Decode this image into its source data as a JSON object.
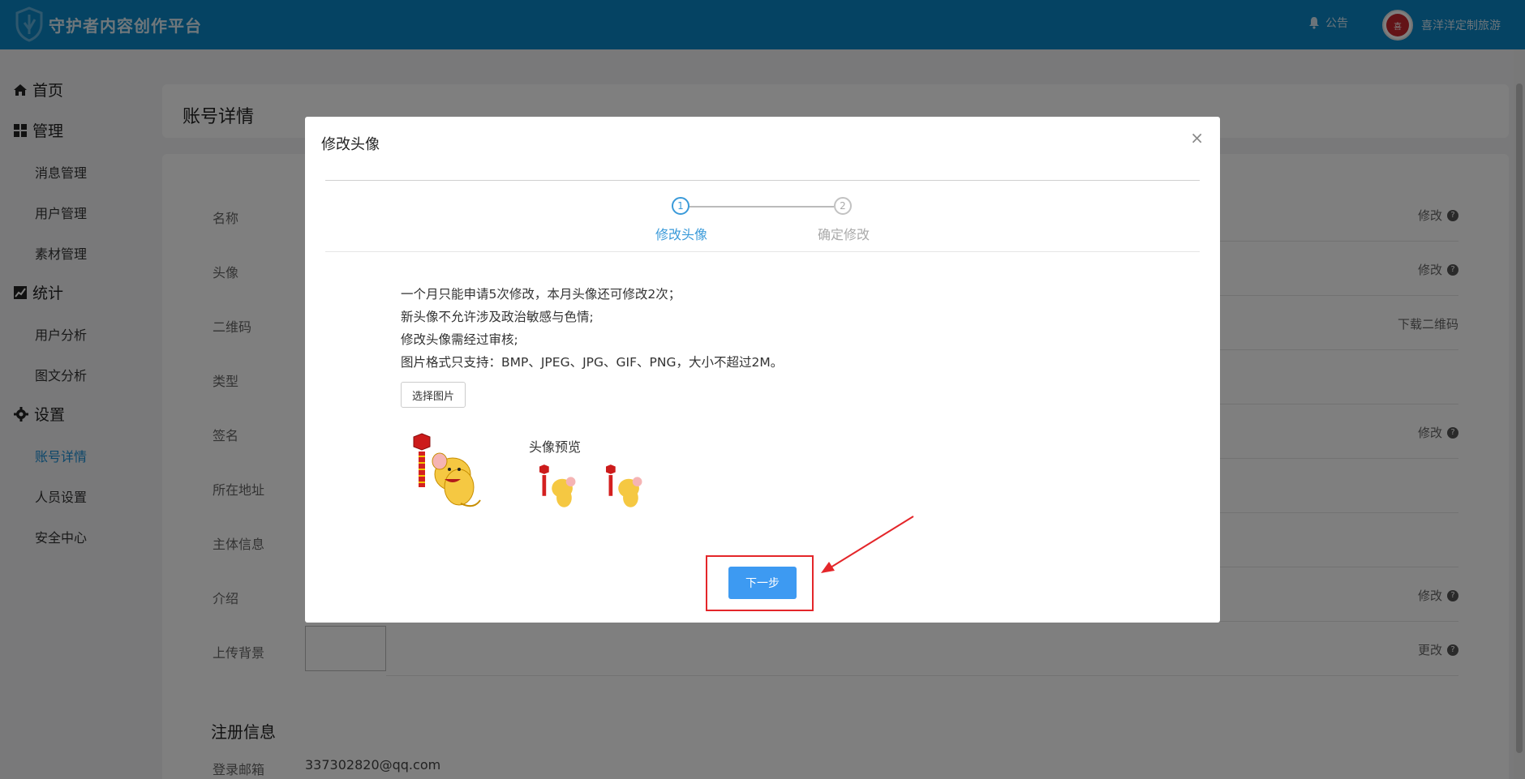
{
  "topbar": {
    "brand": "守护者内容创作平台",
    "notice_label": "公告",
    "username": "喜洋洋定制旅游",
    "avatar_text": "喜"
  },
  "sidebar": {
    "home": "首页",
    "manage": "管理",
    "manage_items": [
      "消息管理",
      "用户管理",
      "素材管理"
    ],
    "stats": "统计",
    "stats_items": [
      "用户分析",
      "图文分析"
    ],
    "settings": "设置",
    "settings_items": [
      "账号详情",
      "人员设置",
      "安全中心"
    ]
  },
  "page": {
    "title": "账号详情",
    "rows": [
      {
        "label": "名称",
        "action": "修改"
      },
      {
        "label": "头像",
        "action": "修改"
      },
      {
        "label": "二维码",
        "action": "下载二维码"
      },
      {
        "label": "类型",
        "action": ""
      },
      {
        "label": "签名",
        "action": "修改"
      },
      {
        "label": "所在地址",
        "action": ""
      },
      {
        "label": "主体信息",
        "action": ""
      },
      {
        "label": "介绍",
        "action": "修改"
      },
      {
        "label": "上传背景",
        "action": "更改"
      }
    ],
    "section_title": "注册信息",
    "email_label": "登录邮箱",
    "email_value": "337302820@qq.com"
  },
  "modal": {
    "title": "修改头像",
    "close_glyph": "×",
    "steps": [
      {
        "number": "1",
        "label": "修改头像"
      },
      {
        "number": "2",
        "label": "确定修改"
      }
    ],
    "rules": [
      "一个月只能申请5次修改，本月头像还可修改2次；",
      "新头像不允许涉及政治敏感与色情;",
      "修改头像需经过审核;",
      "图片格式只支持：BMP、JPEG、JPG、GIF、PNG，大小不超过2M。"
    ],
    "select_button": "选择图片",
    "preview_label": "头像预览",
    "next_button": "下一步"
  },
  "colors": {
    "topbar": "#0a86c6",
    "active": "#1a8fd6",
    "primary_button": "#3d9af2",
    "highlight": "#e4262a"
  },
  "icons": [
    "shield-logo-icon",
    "bell-icon",
    "home-icon",
    "grid-icon",
    "chart-icon",
    "gear-icon",
    "question-icon",
    "close-icon"
  ]
}
